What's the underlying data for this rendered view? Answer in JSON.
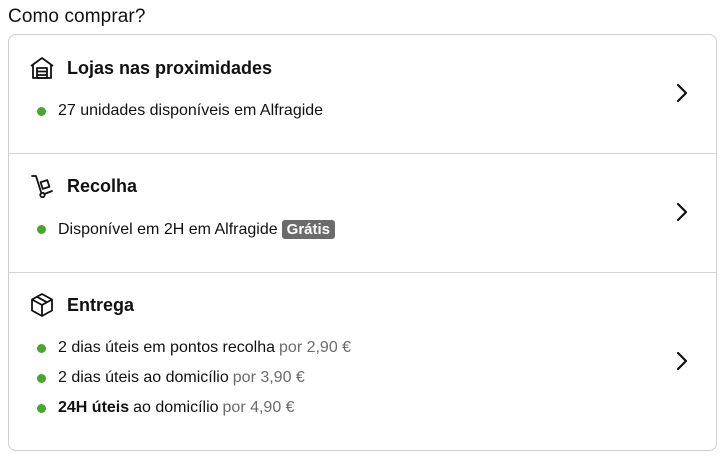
{
  "page_title": "Como comprar?",
  "options": [
    {
      "icon": "store-icon",
      "title": "Lojas nas proximidades",
      "lines": [
        {
          "text": "27 unidades disponíveis em Alfragide"
        }
      ]
    },
    {
      "icon": "hand-truck-icon",
      "title": "Recolha",
      "lines": [
        {
          "text": "Disponível em 2H em Alfragide",
          "badge": "Grátis"
        }
      ]
    },
    {
      "icon": "package-icon",
      "title": "Entrega",
      "lines": [
        {
          "text": "2 dias úteis em pontos recolha",
          "price": "por 2,90 €"
        },
        {
          "text": "2 dias úteis ao domicílio",
          "price": "por 3,90 €"
        },
        {
          "bold": "24H úteis",
          "text": "ao domicílio",
          "price": "por 4,90 €"
        }
      ]
    }
  ],
  "colors": {
    "availability_dot": "#46a72c",
    "badge_bg": "#6b6b6b",
    "muted_text": "#6b6b6b"
  }
}
